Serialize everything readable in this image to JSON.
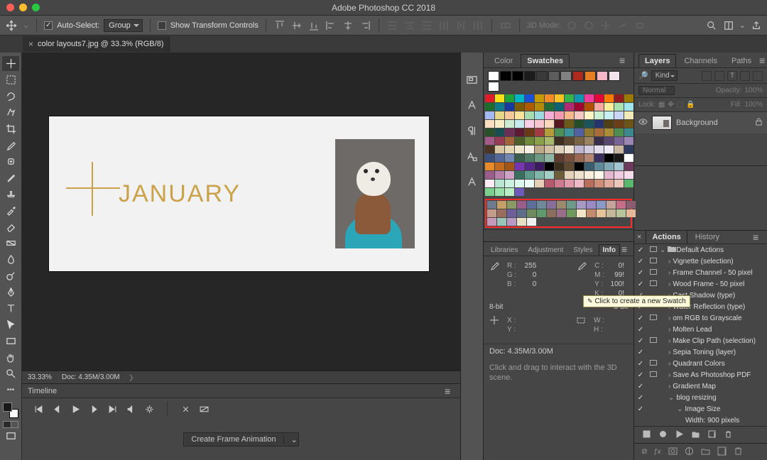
{
  "app": {
    "title": "Adobe Photoshop CC 2018"
  },
  "options": {
    "auto_select": "Auto-Select:",
    "group": "Group",
    "show_transform": "Show Transform Controls",
    "mode3d": "3D Mode:"
  },
  "doc_tab": {
    "name": "color layouts7.jpg @ 33.3% (RGB/8)"
  },
  "canvas": {
    "month": "JANUARY"
  },
  "zoom": {
    "pct": "33.33%",
    "doc": "Doc: 4.35M/3.00M"
  },
  "timeline": {
    "title": "Timeline",
    "create": "Create Frame Animation"
  },
  "color_panel": {
    "tabs": [
      "Color",
      "Swatches"
    ],
    "basic": [
      "#FFFFFF",
      "#000000",
      "#000000",
      "#1C1C1C",
      "#3A3A3A",
      "#5C5C5C",
      "#828282",
      "#B02A1F",
      "#E67E22",
      "#F5B7C5",
      "#F2E4EA",
      "#FFFFFF"
    ],
    "rows": [
      [
        "#E11D2A",
        "#F7E017",
        "#1FA33A",
        "#00B7C3",
        "#1A4FD6",
        "#C39B00",
        "#F28C28",
        "#F7C325",
        "#38B24A",
        "#1296B0",
        "#F23D9D",
        "#E3073A",
        "#FF7A00"
      ],
      [
        "#8F1D1D",
        "#9C7A00",
        "#1E6B2E",
        "#0E7C86",
        "#173A9E",
        "#7A5A00",
        "#B05A00",
        "#B58900",
        "#226B35",
        "#0B6570",
        "#B02A74",
        "#9E0530",
        "#B25000"
      ],
      [
        "#F6A9A3",
        "#FCEE9A",
        "#A8E2B0",
        "#9EE6ED",
        "#A4B8F3",
        "#E6D68C",
        "#F7C99A",
        "#FBE39B",
        "#A9DDB1",
        "#9CD9E0",
        "#F6ADD6",
        "#F29BB0",
        "#F7B98C"
      ],
      [
        "#F4C9C4",
        "#FCF4C4",
        "#CDEFD1",
        "#C8F0F4",
        "#CAD6F7",
        "#F2E9B9",
        "#FBDFC3",
        "#FCEEC4",
        "#CDEBD1",
        "#C4EAEE",
        "#FACDE7",
        "#F8C4D0",
        "#FBD7BD"
      ],
      [
        "#57181E",
        "#6B5A1A",
        "#244D2B",
        "#1B555B",
        "#27336B",
        "#4F3F14",
        "#6B3E18",
        "#6B5416",
        "#285029",
        "#184E52",
        "#6B2E55",
        "#5E1A32",
        "#6B3916"
      ],
      [
        "#A33C42",
        "#B69B3A",
        "#4E8E57",
        "#3E9398",
        "#5361A3",
        "#8E7933",
        "#A86C3A",
        "#A88D35",
        "#4E8C51",
        "#3C898D",
        "#A35A86",
        "#963C57",
        "#A3643A"
      ],
      [
        "#4D5E2B",
        "#6F8A38",
        "#8CA24A",
        "#A7B86B",
        "#3E2E20",
        "#5C4630",
        "#7A6244",
        "#9A8262",
        "#3B2E4A",
        "#5A4770",
        "#796296",
        "#9A85B6",
        "#4A3320"
      ],
      [
        "#D6C7A0",
        "#E3D6B6",
        "#EFE6CF",
        "#F6F0E2",
        "#BDA98A",
        "#D0BFA3",
        "#E0D3BD",
        "#EDE4D3",
        "#C1B6CF",
        "#D3CBE0",
        "#E3DDEE",
        "#EFEBF6",
        "#C9B7A2"
      ],
      [
        "#2E3A5E",
        "#3C4E7A",
        "#54699A",
        "#7286B4",
        "#3A5E4E",
        "#4E7A66",
        "#6E9A85",
        "#8FB6A5",
        "#5E3A2E",
        "#7A4E3C",
        "#9A6954",
        "#B48673",
        "#3A2E5E"
      ],
      [
        "#000000",
        "#1A1A1A",
        "#FFFFFF",
        "#E88A2A",
        "#C46A1E",
        "#A35418",
        "#7735B0",
        "#562788",
        "#3A1A5E",
        "#000000",
        "#3A2E1E",
        "#5E4A32",
        "#000000"
      ],
      [
        "#3A5E6E",
        "#5E8A9A",
        "#7FA9B6",
        "#A3C5CF",
        "#6E3A5E",
        "#9A5E8A",
        "#B67FA9",
        "#CFA3C5",
        "#3A6E5E",
        "#5E9A8A",
        "#7FB6A9",
        "#A3CFC5",
        "#6E5E3A"
      ],
      [
        "#E6D2B8",
        "#F0E2CC",
        "#F7EEDC",
        "#FCF6EB",
        "#E6B8CF",
        "#F0CCE0",
        "#F7DCEC",
        "#FCEBF4",
        "#B8E6D2",
        "#CCF0E2",
        "#DCF7EE",
        "#EBFCF6",
        "#E6CFB8"
      ],
      [
        "#B85A6E",
        "#CF7A8E",
        "#E09AAA",
        "#EDBAC6",
        "#B86E5A",
        "#CF8E7A",
        "#E0AA9A",
        "#EDC6BA",
        "#5AB86E",
        "#7ACF8E",
        "#9AE0AA",
        "#BAEDC6",
        "#6E5AB8"
      ]
    ],
    "highlight": [
      [
        "#6E7A8E",
        "#C4A066",
        "#8A9A66",
        "#9A5E8A",
        "#5E6E9A",
        "#6E8A9A",
        "#8A6E9A",
        "#9A8A6E",
        "#6E9A8A",
        "#A49AC4",
        "#9A8AC4",
        "#8A9AC4",
        "#C4A49A"
      ],
      [
        "#C46E8A",
        "#8A5E6E",
        "#C49A8A",
        "#9A6E5E",
        "#6E5E9A",
        "#5E6E8A",
        "#6E8A5E",
        "#5E9A6E",
        "#8A6E5E",
        "#9A6E8A",
        "#6E9A5E",
        "#F2E4C8",
        "#C48A6E"
      ],
      [
        "#E6C49A",
        "#C4B89A",
        "#B8C49A",
        "#E6B89A",
        "#C49AB8",
        "#9AC4B8",
        "#B89AC4",
        "#E6E0C4",
        "#f0f0f0",
        "#ffffff",
        "#ffffff",
        "#ffffff",
        "#ffffff"
      ]
    ],
    "tooltip": "Click to create a new Swatch"
  },
  "lib_tabs": [
    "Libraries",
    "Adjustment",
    "Styles",
    "Info"
  ],
  "info": {
    "rgb": {
      "R": "255",
      "G": "0",
      "B": "0"
    },
    "cmyk": {
      "C": "0!",
      "M": "99!",
      "Y": "100!",
      "K": "0!"
    },
    "bit1": "8-bit",
    "bit2": "8-bit",
    "xy": {
      "X": "",
      "Y": ""
    },
    "wh": {
      "W": "",
      "H": ""
    },
    "doc": "Doc: 4.35M/3.00M",
    "hint": "Click and drag to interact with the 3D scene."
  },
  "layers": {
    "tabs": [
      "Layers",
      "Channels",
      "Paths"
    ],
    "kind": "Kind",
    "blend": "Normal",
    "opacity_l": "Opacity:",
    "opacity_v": "100%",
    "lock_l": "Lock:",
    "fill_l": "Fill:",
    "fill_v": "100%",
    "layer": {
      "name": "Background"
    }
  },
  "actions": {
    "tabs": [
      "Actions",
      "History"
    ],
    "items": [
      {
        "check": true,
        "dialog": true,
        "folder": true,
        "caret": "v",
        "label": "Default Actions",
        "indent": 0
      },
      {
        "check": true,
        "dialog": true,
        "caret": ">",
        "label": "Vignette (selection)",
        "indent": 1
      },
      {
        "check": true,
        "dialog": true,
        "caret": ">",
        "label": "Frame Channel - 50 pixel",
        "indent": 1
      },
      {
        "check": true,
        "dialog": true,
        "caret": ">",
        "label": "Wood Frame - 50 pixel",
        "indent": 1
      },
      {
        "check": true,
        "caret": ">",
        "label": "Cast Shadow (type)",
        "indent": 1
      },
      {
        "check": true,
        "caret": ">",
        "label": "Water Reflection (type)",
        "indent": 1
      },
      {
        "check": true,
        "dialog": true,
        "caret": ">",
        "label": "om RGB to Grayscale",
        "indent": 1
      },
      {
        "check": true,
        "caret": ">",
        "label": "Molten Lead",
        "indent": 1
      },
      {
        "check": true,
        "dialog": true,
        "caret": ">",
        "label": "Make Clip Path (selection)",
        "indent": 1
      },
      {
        "check": true,
        "caret": ">",
        "label": "Sepia Toning (layer)",
        "indent": 1
      },
      {
        "check": true,
        "dialog": true,
        "caret": ">",
        "label": "Quadrant Colors",
        "indent": 1
      },
      {
        "check": true,
        "dialog": true,
        "caret": ">",
        "label": "Save As Photoshop PDF",
        "indent": 1
      },
      {
        "check": true,
        "caret": ">",
        "label": "Gradient Map",
        "indent": 1
      },
      {
        "check": true,
        "caret": "v",
        "label": "blog resizing",
        "indent": 1
      },
      {
        "check": true,
        "caret": "v",
        "label": "Image Size",
        "indent": 2
      },
      {
        "label": "Width: 900 pixels",
        "indent": 3
      }
    ]
  }
}
